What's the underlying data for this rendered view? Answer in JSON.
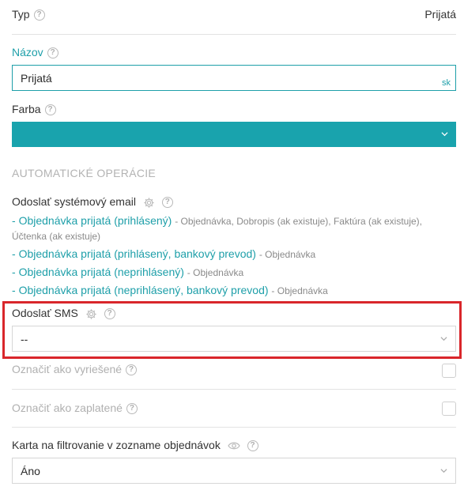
{
  "typ": {
    "label": "Typ",
    "value": "Prijatá"
  },
  "nazov": {
    "label": "Názov",
    "value": "Prijatá",
    "lang": "sk"
  },
  "farba": {
    "label": "Farba",
    "color": "#19a3ad"
  },
  "section_title": "AUTOMATICKÉ OPERÁCIE",
  "email": {
    "label": "Odoslať systémový email",
    "items": [
      {
        "link": "Objednávka prijatá (prihlásený)",
        "desc": "- Objednávka, Dobropis (ak existuje), Faktúra (ak existuje), Účtenka (ak existuje)"
      },
      {
        "link": "Objednávka prijatá (prihlásený, bankový prevod)",
        "desc": "- Objednávka"
      },
      {
        "link": "Objednávka prijatá (neprihlásený)",
        "desc": "- Objednávka"
      },
      {
        "link": "Objednávka prijatá (neprihlásený, bankový prevod)",
        "desc": "- Objednávka"
      }
    ]
  },
  "sms": {
    "label": "Odoslať SMS",
    "value": "--"
  },
  "resolved": {
    "label": "Označiť ako vyriešené"
  },
  "paid": {
    "label": "Označiť ako zaplatené"
  },
  "filter_card": {
    "label": "Karta na filtrovanie v zozname objednávok",
    "value": "Áno"
  },
  "colors": {
    "accent": "#1e9fa9",
    "highlight": "#d9262b"
  }
}
